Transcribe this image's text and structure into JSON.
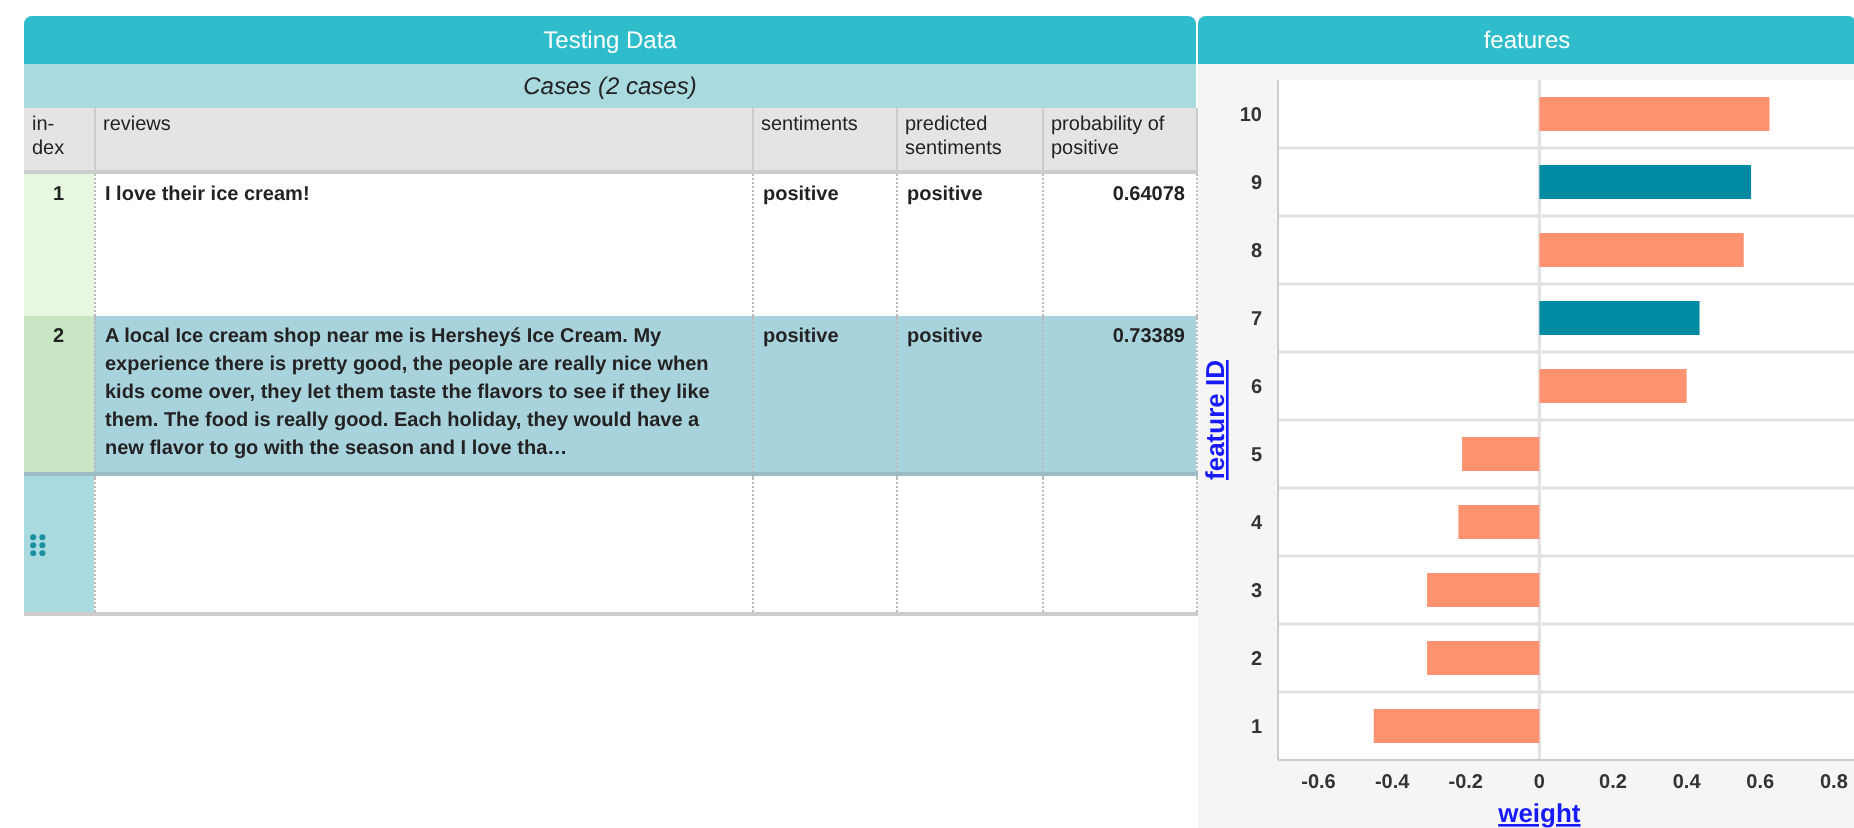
{
  "table_panel": {
    "title": "Testing Data",
    "subtitle": "Cases (2 cases)",
    "columns": [
      "in-dex",
      "reviews",
      "sentiments",
      "predicted sentiments",
      "probability of positive"
    ],
    "rows": [
      {
        "index": "1",
        "review": "I love their ice cream!",
        "sentiment": "positive",
        "predicted": "positive",
        "probability": "0.64078",
        "selected": false
      },
      {
        "index": "2",
        "review": "A local Ice cream shop near me is Hersheyś Ice Cream. My experience there is pretty good, the people are really nice when kids come over, they let them taste the flavors to see if they like them. The food is really good. Each holiday, they would have a new flavor to go with the season and I love tha…",
        "sentiment": "positive",
        "predicted": "positive",
        "probability": "0.73389",
        "selected": true
      }
    ]
  },
  "chart_panel": {
    "title": "features",
    "chart_data": {
      "type": "bar",
      "orientation": "horizontal",
      "stacked": true,
      "xlabel": "weight",
      "ylabel": "feature ID",
      "categories": [
        "10",
        "9",
        "8",
        "7",
        "6",
        "5",
        "4",
        "3",
        "2",
        "1"
      ],
      "series": [
        {
          "color": "#ff9270",
          "values": [
            0.625,
            null,
            0.555,
            null,
            0.4,
            -0.21,
            -0.22,
            -0.305,
            -0.305,
            -0.45
          ]
        },
        {
          "color": "#008ba3",
          "values": [
            null,
            0.575,
            null,
            0.435,
            null,
            null,
            null,
            null,
            null,
            null
          ]
        }
      ],
      "xlim": [
        -0.71,
        0.86
      ],
      "xticks": [
        -0.6,
        -0.4,
        -0.2,
        0,
        0.2,
        0.4,
        0.6,
        0.8
      ]
    }
  }
}
